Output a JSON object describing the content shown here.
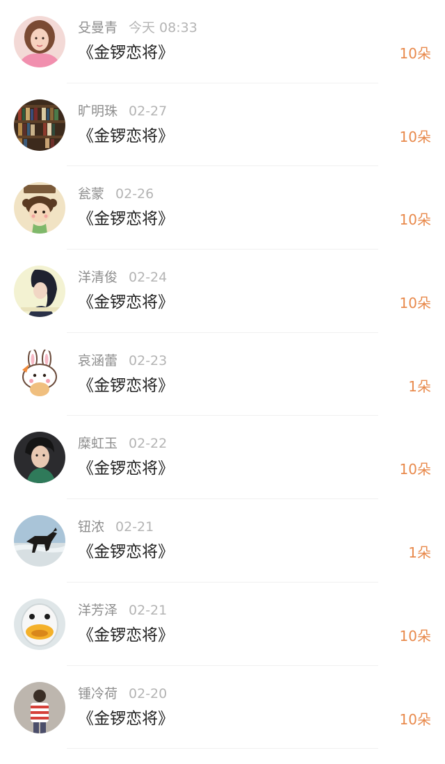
{
  "accent_color": "#e8894b",
  "items": [
    {
      "name": "殳曼青",
      "time": "今天 08:33",
      "title": "《金锣恋将》",
      "amount": "10朵",
      "avatar_icon": "avatar-girl-pink-icon"
    },
    {
      "name": "旷明珠",
      "time": "02-27",
      "title": "《金锣恋将》",
      "amount": "10朵",
      "avatar_icon": "avatar-bookshelf-icon"
    },
    {
      "name": "瓮蒙",
      "time": "02-26",
      "title": "《金锣恋将》",
      "amount": "10朵",
      "avatar_icon": "avatar-cartoon-girl-icon"
    },
    {
      "name": "洋清俊",
      "time": "02-24",
      "title": "《金锣恋将》",
      "amount": "10朵",
      "avatar_icon": "avatar-dark-hair-girl-icon"
    },
    {
      "name": "哀涵蕾",
      "time": "02-23",
      "title": "《金锣恋将》",
      "amount": "1朵",
      "avatar_icon": "avatar-bunny-cartoon-icon"
    },
    {
      "name": "糜虹玉",
      "time": "02-22",
      "title": "《金锣恋将》",
      "amount": "10朵",
      "avatar_icon": "avatar-man-portrait-icon"
    },
    {
      "name": "钮浓",
      "time": "02-21",
      "title": "《金锣恋将》",
      "amount": "1朵",
      "avatar_icon": "avatar-horse-beach-icon"
    },
    {
      "name": "洋芳泽",
      "time": "02-21",
      "title": "《金锣恋将》",
      "amount": "10朵",
      "avatar_icon": "avatar-duck-mask-icon"
    },
    {
      "name": "锺冷荷",
      "time": "02-20",
      "title": "《金锣恋将》",
      "amount": "10朵",
      "avatar_icon": "avatar-boy-striped-shirt-icon"
    }
  ]
}
